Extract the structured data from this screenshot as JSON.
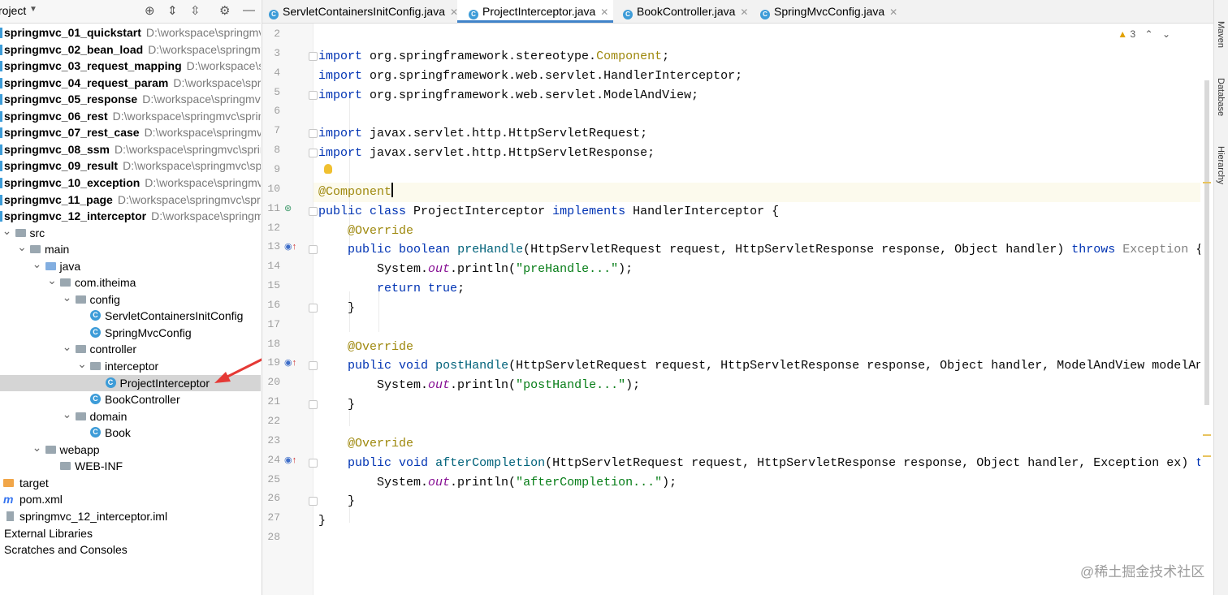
{
  "project_panel": {
    "title": "roject",
    "tree": [
      {
        "label": "springmvc_01_quickstart",
        "path": "D:\\workspace\\springmv",
        "type": "module",
        "indent": 0
      },
      {
        "label": "springmvc_02_bean_load",
        "path": "D:\\workspace\\springmv",
        "type": "module",
        "indent": 0
      },
      {
        "label": "springmvc_03_request_mapping",
        "path": "D:\\workspace\\s",
        "type": "module",
        "indent": 0
      },
      {
        "label": "springmvc_04_request_param",
        "path": "D:\\workspace\\spri",
        "type": "module",
        "indent": 0
      },
      {
        "label": "springmvc_05_response",
        "path": "D:\\workspace\\springmvc",
        "type": "module",
        "indent": 0
      },
      {
        "label": "springmvc_06_rest",
        "path": "D:\\workspace\\springmvc\\sprin",
        "type": "module",
        "indent": 0
      },
      {
        "label": "springmvc_07_rest_case",
        "path": "D:\\workspace\\springmvc",
        "type": "module",
        "indent": 0
      },
      {
        "label": "springmvc_08_ssm",
        "path": "D:\\workspace\\springmvc\\sprin",
        "type": "module",
        "indent": 0
      },
      {
        "label": "springmvc_09_result",
        "path": "D:\\workspace\\springmvc\\sp",
        "type": "module",
        "indent": 0
      },
      {
        "label": "springmvc_10_exception",
        "path": "D:\\workspace\\springmv",
        "type": "module",
        "indent": 0
      },
      {
        "label": "springmvc_11_page",
        "path": "D:\\workspace\\springmvc\\spr",
        "type": "module",
        "indent": 0
      },
      {
        "label": "springmvc_12_interceptor",
        "path": "D:\\workspace\\springm",
        "type": "module",
        "indent": 0
      },
      {
        "label": "src",
        "path": "",
        "type": "folder",
        "indent": 1
      },
      {
        "label": "main",
        "path": "",
        "type": "folder",
        "indent": 2
      },
      {
        "label": "java",
        "path": "",
        "type": "src",
        "indent": 3
      },
      {
        "label": "com.itheima",
        "path": "",
        "type": "folder",
        "indent": 4
      },
      {
        "label": "config",
        "path": "",
        "type": "folder",
        "indent": 5
      },
      {
        "label": "ServletContainersInitConfig",
        "path": "",
        "type": "class",
        "indent": 6
      },
      {
        "label": "SpringMvcConfig",
        "path": "",
        "type": "class",
        "indent": 6
      },
      {
        "label": "controller",
        "path": "",
        "type": "folder",
        "indent": 5
      },
      {
        "label": "interceptor",
        "path": "",
        "type": "folder",
        "indent": 6
      },
      {
        "label": "ProjectInterceptor",
        "path": "",
        "type": "class",
        "indent": 7,
        "selected": true
      },
      {
        "label": "BookController",
        "path": "",
        "type": "class",
        "indent": 6
      },
      {
        "label": "domain",
        "path": "",
        "type": "folder",
        "indent": 5
      },
      {
        "label": "Book",
        "path": "",
        "type": "class",
        "indent": 6
      },
      {
        "label": "webapp",
        "path": "",
        "type": "web",
        "indent": 3
      },
      {
        "label": "WEB-INF",
        "path": "",
        "type": "folder",
        "indent": 4
      },
      {
        "label": "target",
        "path": "",
        "type": "orange",
        "indent": 1
      },
      {
        "label": "pom.xml",
        "path": "",
        "type": "maven",
        "indent": 1
      },
      {
        "label": "springmvc_12_interceptor.iml",
        "path": "",
        "type": "iml",
        "indent": 1
      },
      {
        "label": "External Libraries",
        "path": "",
        "type": "libs",
        "indent": 0
      },
      {
        "label": "Scratches and Consoles",
        "path": "",
        "type": "scratch",
        "indent": 0
      }
    ]
  },
  "tabs": [
    {
      "label": "ServletContainersInitConfig.java",
      "active": false
    },
    {
      "label": "ProjectInterceptor.java",
      "active": true
    },
    {
      "label": "BookController.java",
      "active": false
    },
    {
      "label": "SpringMvcConfig.java",
      "active": false
    }
  ],
  "editor": {
    "warning_count": "3",
    "line_numbers": [
      "2",
      "3",
      "4",
      "5",
      "6",
      "7",
      "8",
      "9",
      "10",
      "11",
      "12",
      "13",
      "14",
      "15",
      "16",
      "17",
      "18",
      "19",
      "20",
      "21",
      "22",
      "23",
      "24",
      "25",
      "26",
      "27",
      "28"
    ],
    "code_lines": [
      "",
      "import org.springframework.stereotype.Component;",
      "import org.springframework.web.servlet.HandlerInterceptor;",
      "import org.springframework.web.servlet.ModelAndView;",
      "",
      "import javax.servlet.http.HttpServletRequest;",
      "import javax.servlet.http.HttpServletResponse;",
      "",
      "@Component",
      "public class ProjectInterceptor implements HandlerInterceptor {",
      "    @Override",
      "    public boolean preHandle(HttpServletRequest request, HttpServletResponse response, Object handler) throws Exception {",
      "        System.out.println(\"preHandle...\");",
      "        return true;",
      "    }",
      "",
      "    @Override",
      "    public void postHandle(HttpServletRequest request, HttpServletResponse response, Object handler, ModelAndView modelAnd",
      "        System.out.println(\"postHandle...\");",
      "    }",
      "",
      "    @Override",
      "    public void afterCompletion(HttpServletRequest request, HttpServletResponse response, Object handler, Exception ex) th",
      "        System.out.println(\"afterCompletion...\");",
      "    }",
      "}",
      ""
    ]
  },
  "right_strip": {
    "maven": "Maven",
    "database": "Database",
    "hierarchy": "Hierarchy"
  },
  "watermark": "@稀土掘金技术社区",
  "colors": {
    "keyword": "#0033b3",
    "annotation": "#9e880d",
    "string": "#067d17",
    "selection": "#d5d5d5",
    "arrow": "#e53935"
  }
}
